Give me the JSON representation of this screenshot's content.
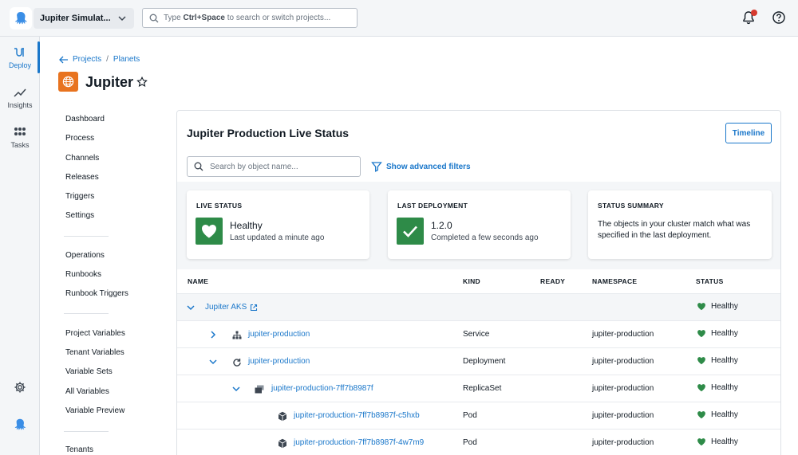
{
  "topbar": {
    "space_name": "Jupiter Simulat...",
    "search_prefix": "Type ",
    "search_shortcut": "Ctrl+Space",
    "search_suffix": " to search or switch projects..."
  },
  "leftnav": {
    "items": [
      {
        "label": "Deploy",
        "icon": "deploy-icon",
        "active": true
      },
      {
        "label": "Insights",
        "icon": "insights-icon"
      },
      {
        "label": "Tasks",
        "icon": "tasks-icon"
      }
    ]
  },
  "breadcrumb": [
    "Projects",
    "Planets"
  ],
  "project": {
    "title": "Jupiter"
  },
  "sidemenu": {
    "group1": [
      "Dashboard",
      "Process",
      "Channels",
      "Releases",
      "Triggers",
      "Settings"
    ],
    "group2": [
      "Operations",
      "Runbooks",
      "Runbook Triggers"
    ],
    "group3": [
      "Project Variables",
      "Tenant Variables",
      "Variable Sets",
      "All Variables",
      "Variable Preview"
    ],
    "group4": [
      "Tenants"
    ]
  },
  "panel": {
    "title": "Jupiter Production Live Status",
    "timeline_label": "Timeline",
    "search_placeholder": "Search by object name...",
    "advanced_filters_label": "Show advanced filters"
  },
  "cards": {
    "live_status": {
      "label": "LIVE STATUS",
      "value": "Healthy",
      "sub": "Last updated a minute ago"
    },
    "last_deployment": {
      "label": "LAST DEPLOYMENT",
      "value": "1.2.0",
      "sub": "Completed a few seconds ago"
    },
    "status_summary": {
      "label": "STATUS SUMMARY",
      "text": "The objects in your cluster match what was specified in the last deployment."
    }
  },
  "table": {
    "headers": {
      "name": "NAME",
      "kind": "KIND",
      "ready": "READY",
      "namespace": "NAMESPACE",
      "status": "STATUS"
    },
    "rows": [
      {
        "name": "Jupiter AKS",
        "kind": "",
        "namespace": "",
        "status": "Healthy"
      },
      {
        "name": "jupiter-production",
        "kind": "Service",
        "namespace": "jupiter-production",
        "status": "Healthy"
      },
      {
        "name": "jupiter-production",
        "kind": "Deployment",
        "namespace": "jupiter-production",
        "status": "Healthy"
      },
      {
        "name": "jupiter-production-7ff7b8987f",
        "kind": "ReplicaSet",
        "namespace": "jupiter-production",
        "status": "Healthy"
      },
      {
        "name": "jupiter-production-7ff7b8987f-c5hxb",
        "kind": "Pod",
        "namespace": "jupiter-production",
        "status": "Healthy"
      },
      {
        "name": "jupiter-production-7ff7b8987f-4w7m9",
        "kind": "Pod",
        "namespace": "jupiter-production",
        "status": "Healthy"
      }
    ]
  },
  "colors": {
    "accent": "#1a77ca",
    "healthy": "#2e8b48",
    "project_icon": "#e8731f",
    "notification": "#d63a2f"
  }
}
